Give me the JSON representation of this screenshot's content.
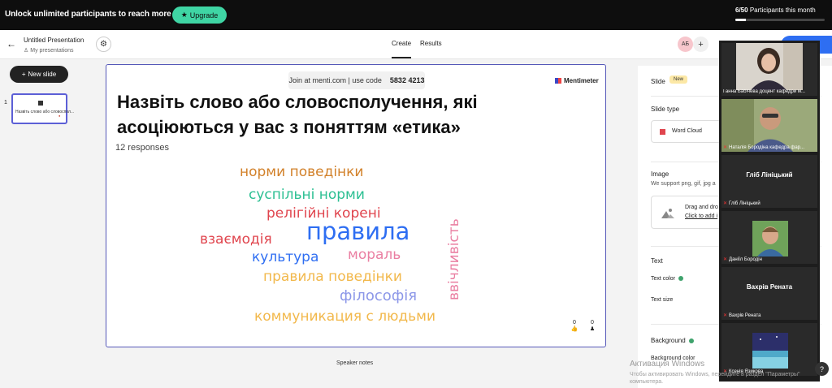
{
  "banner": {
    "message": "Unlock unlimited participants to reach more people.",
    "upgrade_label": "Upgrade",
    "participants_count": "6/50",
    "participants_label": "Participants this month",
    "participants_fraction": 0.12
  },
  "header": {
    "title": "Untitled Presentation",
    "subtitle": "My presentations",
    "tabs": [
      {
        "label": "Create"
      },
      {
        "label": "Results"
      }
    ],
    "avatar_initials": "AБ"
  },
  "left_panel": {
    "new_slide_label": "New slide",
    "slide_number": "1",
    "thumb_text": "Назвіть слово або словоспол..."
  },
  "slide": {
    "join_text": "Join at menti.com | use code",
    "join_code": "5832 4213",
    "brand": "Mentimeter",
    "question": "Назвіть слово або словосполучення, які асоціюються у вас з поняттям «етика»",
    "responses": "12 responses",
    "words": [
      {
        "text": "норми поведінки",
        "color": "#d2812a"
      },
      {
        "text": "суспільні норми",
        "color": "#2bbf92"
      },
      {
        "text": "релігійні корені",
        "color": "#e0454e"
      },
      {
        "text": "взаємодія",
        "color": "#e0454e"
      },
      {
        "text": "правила",
        "color": "#2e6ef2"
      },
      {
        "text": "культура",
        "color": "#2e6ef2"
      },
      {
        "text": "мораль",
        "color": "#ea7fa2"
      },
      {
        "text": "правила поведінки",
        "color": "#f2b84b"
      },
      {
        "text": "філософія",
        "color": "#8c97e8"
      },
      {
        "text": "коммуникация с людьми",
        "color": "#f2b84b"
      },
      {
        "text": "ввічливість",
        "color": "#ea7fa2"
      }
    ],
    "icon_counts": [
      "0",
      "0"
    ]
  },
  "speaker_notes": "Speaker notes",
  "right_panel": {
    "slide_label": "Slide",
    "new_badge": "New",
    "slide_type_label": "Slide type",
    "slide_type_value": "Word Cloud",
    "image_label": "Image",
    "image_hint": "We support png, gif, jpg a",
    "drag_text": "Drag and dro",
    "click_text": "Click to add i",
    "text_label": "Text",
    "text_color_label": "Text color",
    "text_size_label": "Text size",
    "background_label": "Background",
    "background_color_label": "Background color"
  },
  "video_strip": {
    "participants": [
      {
        "name": "Ганна Бабічева доцент кафедри м..."
      },
      {
        "name": "Наталія Бородіна кафедра фар..."
      },
      {
        "name": "Гліб Лініцький",
        "center": "Гліб Лініцький"
      },
      {
        "name": "Даніїл Бородін"
      },
      {
        "name": "Вахрів Рената",
        "center": "Вахрів Рената"
      },
      {
        "name": "Ксенія Язикова"
      }
    ]
  },
  "watermark": {
    "line1": "Активация Windows",
    "line2": "Чтобы активировать Windows, перейдите в раздел \"Параметры\"",
    "line3": "компьютера."
  },
  "help_label": "?"
}
